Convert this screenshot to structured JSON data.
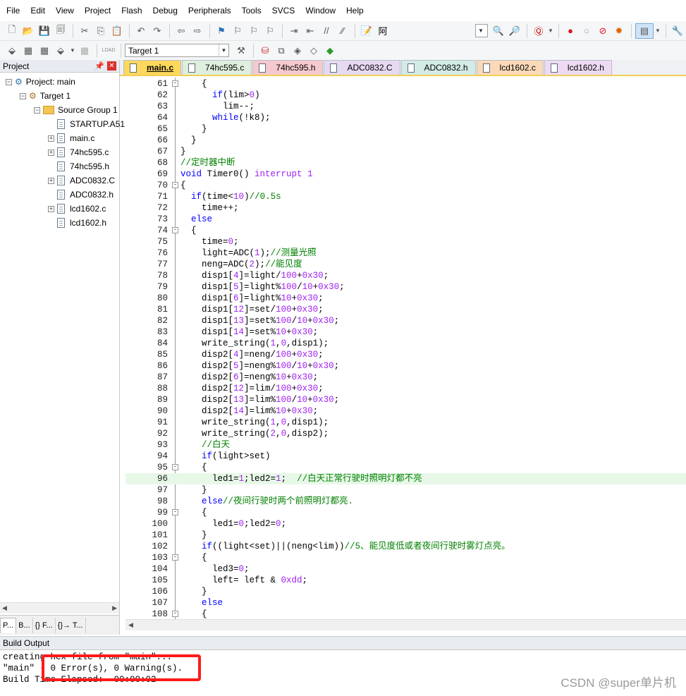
{
  "menu": [
    "File",
    "Edit",
    "View",
    "Project",
    "Flash",
    "Debug",
    "Peripherals",
    "Tools",
    "SVCS",
    "Window",
    "Help"
  ],
  "toolbar": {
    "find_text": "阿",
    "target_combo": "Target 1",
    "load_label": "LOAD"
  },
  "project": {
    "title": "Project",
    "root": "Project: main",
    "target": "Target 1",
    "group": "Source Group 1",
    "files": [
      {
        "name": "STARTUP.A51",
        "expand": false
      },
      {
        "name": "main.c",
        "expand": true
      },
      {
        "name": "74hc595.c",
        "expand": true
      },
      {
        "name": "74hc595.h",
        "expand": false
      },
      {
        "name": "ADC0832.C",
        "expand": true
      },
      {
        "name": "ADC0832.h",
        "expand": false
      },
      {
        "name": "lcd1602.c",
        "expand": true
      },
      {
        "name": "lcd1602.h",
        "expand": false
      }
    ],
    "bottom_tabs": [
      "P...",
      "B...",
      "{} F...",
      "{}→ T..."
    ]
  },
  "editor_tabs": [
    {
      "label": "main.c",
      "color": "#fdd85d",
      "active": true
    },
    {
      "label": "74hc595.c",
      "color": "#dfeedd",
      "active": false
    },
    {
      "label": "74hc595.h",
      "color": "#f6c9cf",
      "active": false
    },
    {
      "label": "ADC0832.C",
      "color": "#e6d9f2",
      "active": false
    },
    {
      "label": "ADC0832.h",
      "color": "#d3ebe6",
      "active": false
    },
    {
      "label": "lcd1602.c",
      "color": "#fbd9b8",
      "active": false
    },
    {
      "label": "lcd1602.h",
      "color": "#eedaf2",
      "active": false
    }
  ],
  "code_lines": [
    {
      "n": "61",
      "fold": "-",
      "t": "    {"
    },
    {
      "n": "62",
      "fold": "",
      "t": "      if(lim>0)"
    },
    {
      "n": "63",
      "fold": "",
      "t": "        lim--;"
    },
    {
      "n": "64",
      "fold": "",
      "t": "      while(!k8);"
    },
    {
      "n": "65",
      "fold": "",
      "t": "    }"
    },
    {
      "n": "66",
      "fold": "",
      "t": "  }"
    },
    {
      "n": "67",
      "fold": "",
      "t": "}"
    },
    {
      "n": "68",
      "fold": "",
      "t": "//定时器中断"
    },
    {
      "n": "69",
      "fold": "",
      "t": "void Timer0() interrupt 1"
    },
    {
      "n": "70",
      "fold": "-",
      "t": "{"
    },
    {
      "n": "71",
      "fold": "",
      "t": "  if(time<10)//0.5s"
    },
    {
      "n": "72",
      "fold": "",
      "t": "    time++;"
    },
    {
      "n": "73",
      "fold": "",
      "t": "  else"
    },
    {
      "n": "74",
      "fold": "-",
      "t": "  {"
    },
    {
      "n": "75",
      "fold": "",
      "t": "    time=0;"
    },
    {
      "n": "76",
      "fold": "",
      "t": "    light=ADC(1);//测量光照"
    },
    {
      "n": "77",
      "fold": "",
      "t": "    neng=ADC(2);//能见度"
    },
    {
      "n": "78",
      "fold": "",
      "t": "    disp1[4]=light/100+0x30;"
    },
    {
      "n": "79",
      "fold": "",
      "t": "    disp1[5]=light%100/10+0x30;"
    },
    {
      "n": "80",
      "fold": "",
      "t": "    disp1[6]=light%10+0x30;"
    },
    {
      "n": "81",
      "fold": "",
      "t": "    disp1[12]=set/100+0x30;"
    },
    {
      "n": "82",
      "fold": "",
      "t": "    disp1[13]=set%100/10+0x30;"
    },
    {
      "n": "83",
      "fold": "",
      "t": "    disp1[14]=set%10+0x30;"
    },
    {
      "n": "84",
      "fold": "",
      "t": "    write_string(1,0,disp1);"
    },
    {
      "n": "85",
      "fold": "",
      "t": "    disp2[4]=neng/100+0x30;"
    },
    {
      "n": "86",
      "fold": "",
      "t": "    disp2[5]=neng%100/10+0x30;"
    },
    {
      "n": "87",
      "fold": "",
      "t": "    disp2[6]=neng%10+0x30;"
    },
    {
      "n": "88",
      "fold": "",
      "t": "    disp2[12]=lim/100+0x30;"
    },
    {
      "n": "89",
      "fold": "",
      "t": "    disp2[13]=lim%100/10+0x30;"
    },
    {
      "n": "90",
      "fold": "",
      "t": "    disp2[14]=lim%10+0x30;"
    },
    {
      "n": "91",
      "fold": "",
      "t": "    write_string(1,0,disp1);"
    },
    {
      "n": "92",
      "fold": "",
      "t": "    write_string(2,0,disp2);"
    },
    {
      "n": "93",
      "fold": "",
      "t": "    //白天"
    },
    {
      "n": "94",
      "fold": "",
      "t": "    if(light>set)"
    },
    {
      "n": "95",
      "fold": "-",
      "t": "    {"
    },
    {
      "n": "96",
      "fold": "",
      "t": "      led1=1;led2=1;  //白天正常行驶时照明灯都不亮",
      "hl": true
    },
    {
      "n": "97",
      "fold": "",
      "t": "    }"
    },
    {
      "n": "98",
      "fold": "",
      "t": "    else//夜间行驶时两个前照明灯都亮."
    },
    {
      "n": "99",
      "fold": "-",
      "t": "    {"
    },
    {
      "n": "100",
      "fold": "",
      "t": "      led1=0;led2=0;"
    },
    {
      "n": "101",
      "fold": "",
      "t": "    }"
    },
    {
      "n": "102",
      "fold": "",
      "t": "    if((light<set)||(neng<lim))//5、能见度低或者夜间行驶时雾灯点亮。"
    },
    {
      "n": "103",
      "fold": "-",
      "t": "    {"
    },
    {
      "n": "104",
      "fold": "",
      "t": "      led3=0;"
    },
    {
      "n": "105",
      "fold": "",
      "t": "      left= left & 0xdd;"
    },
    {
      "n": "106",
      "fold": "",
      "t": "    }"
    },
    {
      "n": "107",
      "fold": "",
      "t": "    else"
    },
    {
      "n": "108",
      "fold": "-",
      "t": "    {"
    }
  ],
  "build": {
    "title": "Build Output",
    "lines": [
      "creating hex file from \"main\"...",
      "\"main\" - 0 Error(s), 0 Warning(s).",
      "Build Time Elapsed:  00:00:02"
    ]
  },
  "watermark": "CSDN @super单片机"
}
